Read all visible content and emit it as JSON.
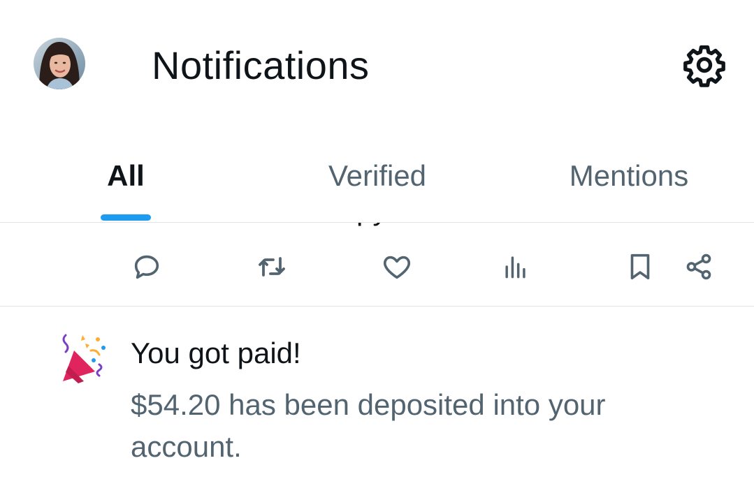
{
  "header": {
    "title": "Notifications",
    "avatar_icon": "profile-photo",
    "settings_icon": "gear-icon"
  },
  "tabs": [
    {
      "label": "All",
      "active": true
    },
    {
      "label": "Verified",
      "active": false
    },
    {
      "label": "Mentions",
      "active": false
    }
  ],
  "action_bar": {
    "icons": [
      "reply-icon",
      "retweet-icon",
      "like-icon",
      "views-icon",
      "bookmark-icon",
      "share-icon"
    ]
  },
  "notification": {
    "icon": "party-popper-icon",
    "title": "You got paid!",
    "body": "$54.20 has been deposited into your account."
  },
  "colors": {
    "accent": "#1d9bf0",
    "text_primary": "#0f1419",
    "text_secondary": "#536471",
    "divider": "#dfe5e9"
  }
}
